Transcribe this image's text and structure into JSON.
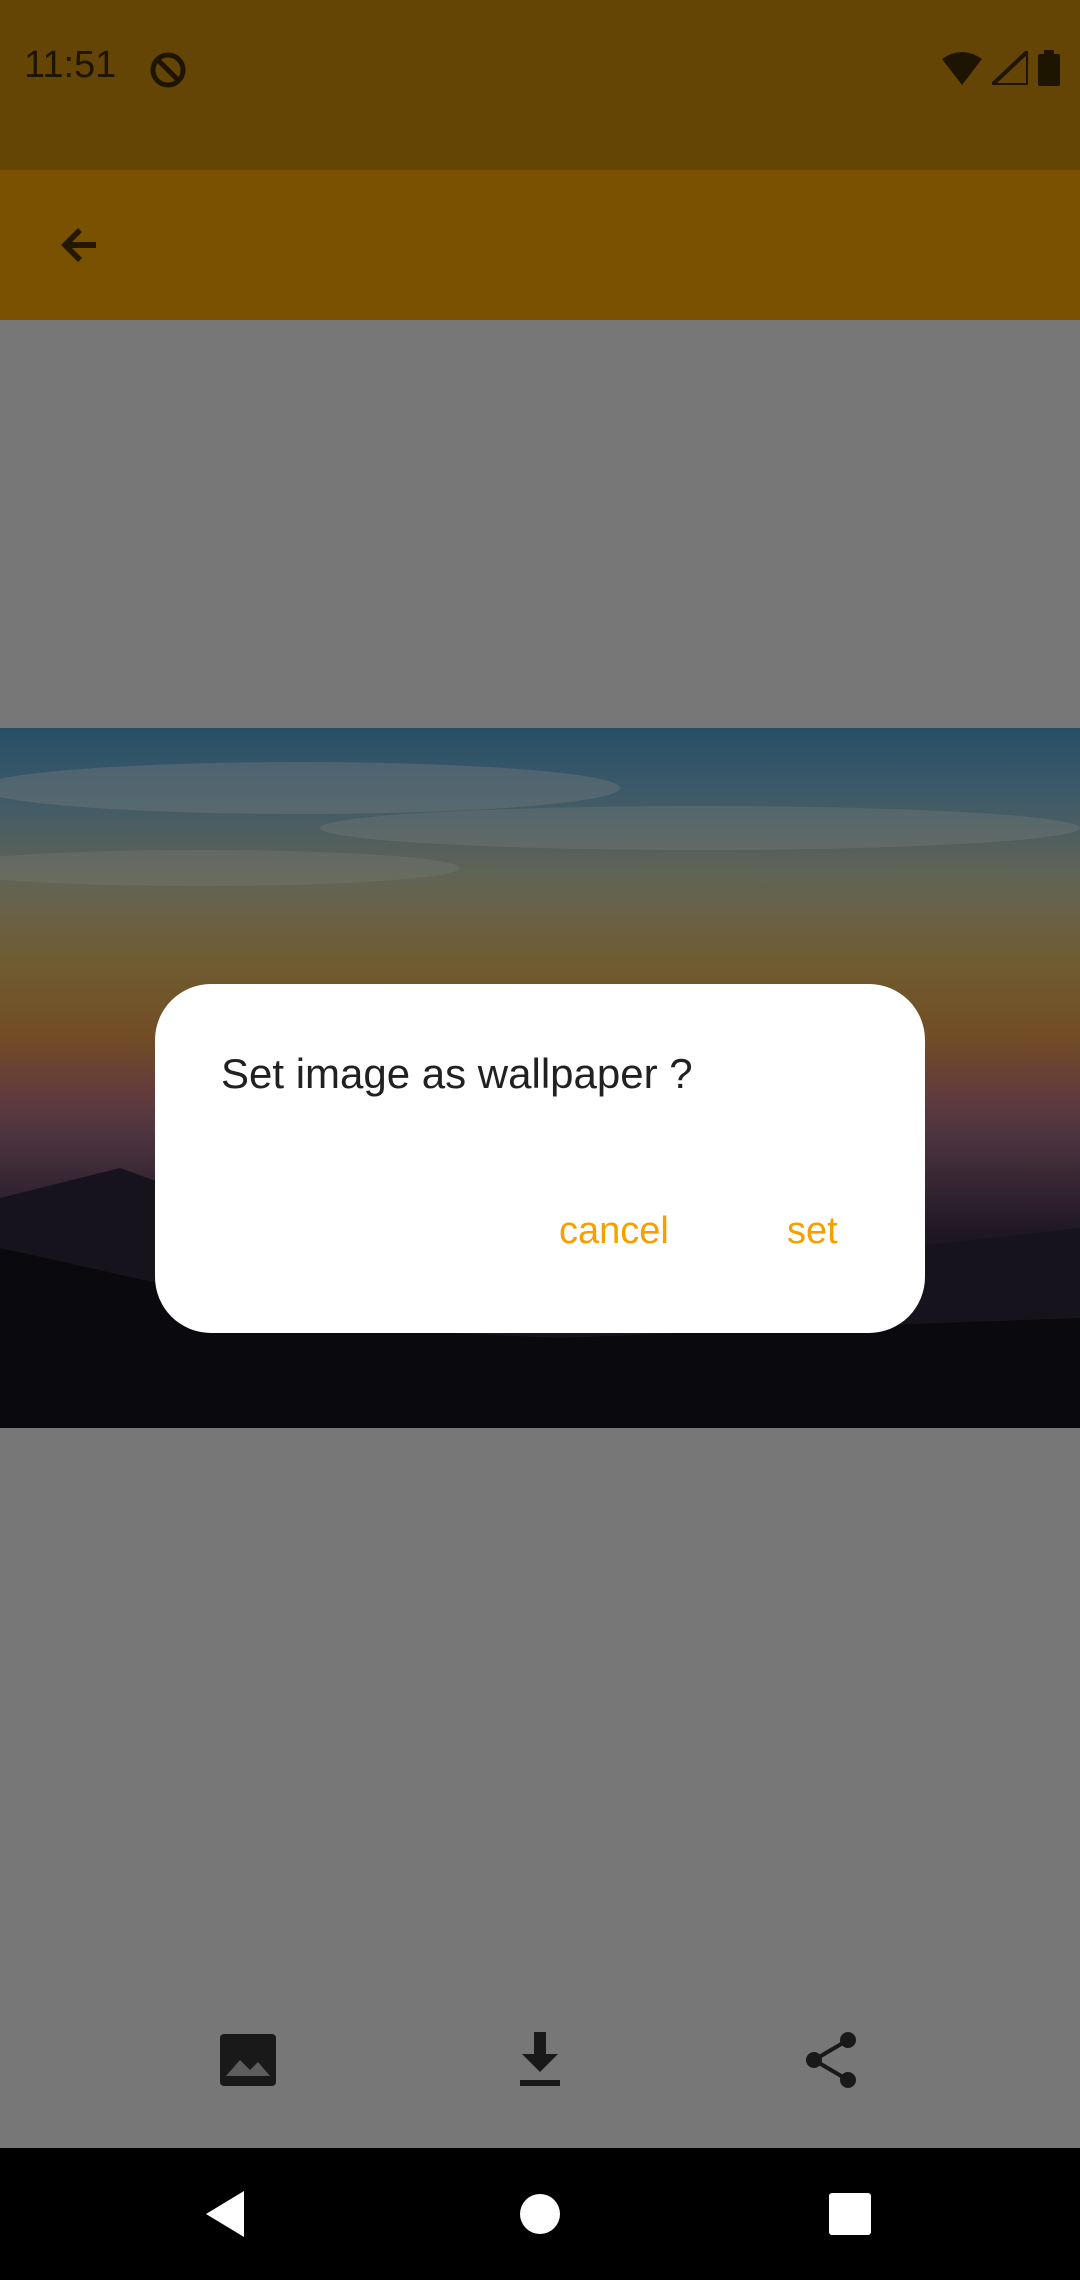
{
  "status_bar": {
    "time": "11:51",
    "icons": [
      "do-not-disturb-icon",
      "wifi-icon",
      "cellular-signal-icon",
      "battery-icon"
    ]
  },
  "app_bar": {
    "back_icon": "arrow-back-icon",
    "color": "#f5a300"
  },
  "bottom_actions": [
    {
      "icon": "wallpaper-icon"
    },
    {
      "icon": "download-icon"
    },
    {
      "icon": "share-icon"
    }
  ],
  "dialog": {
    "title": "Set image as wallpaper ?",
    "cancel_label": "cancel",
    "set_label": "set",
    "accent_color": "#f5a000"
  },
  "navigation": {
    "icons": [
      "nav-back-icon",
      "nav-home-icon",
      "nav-recents-icon"
    ]
  }
}
